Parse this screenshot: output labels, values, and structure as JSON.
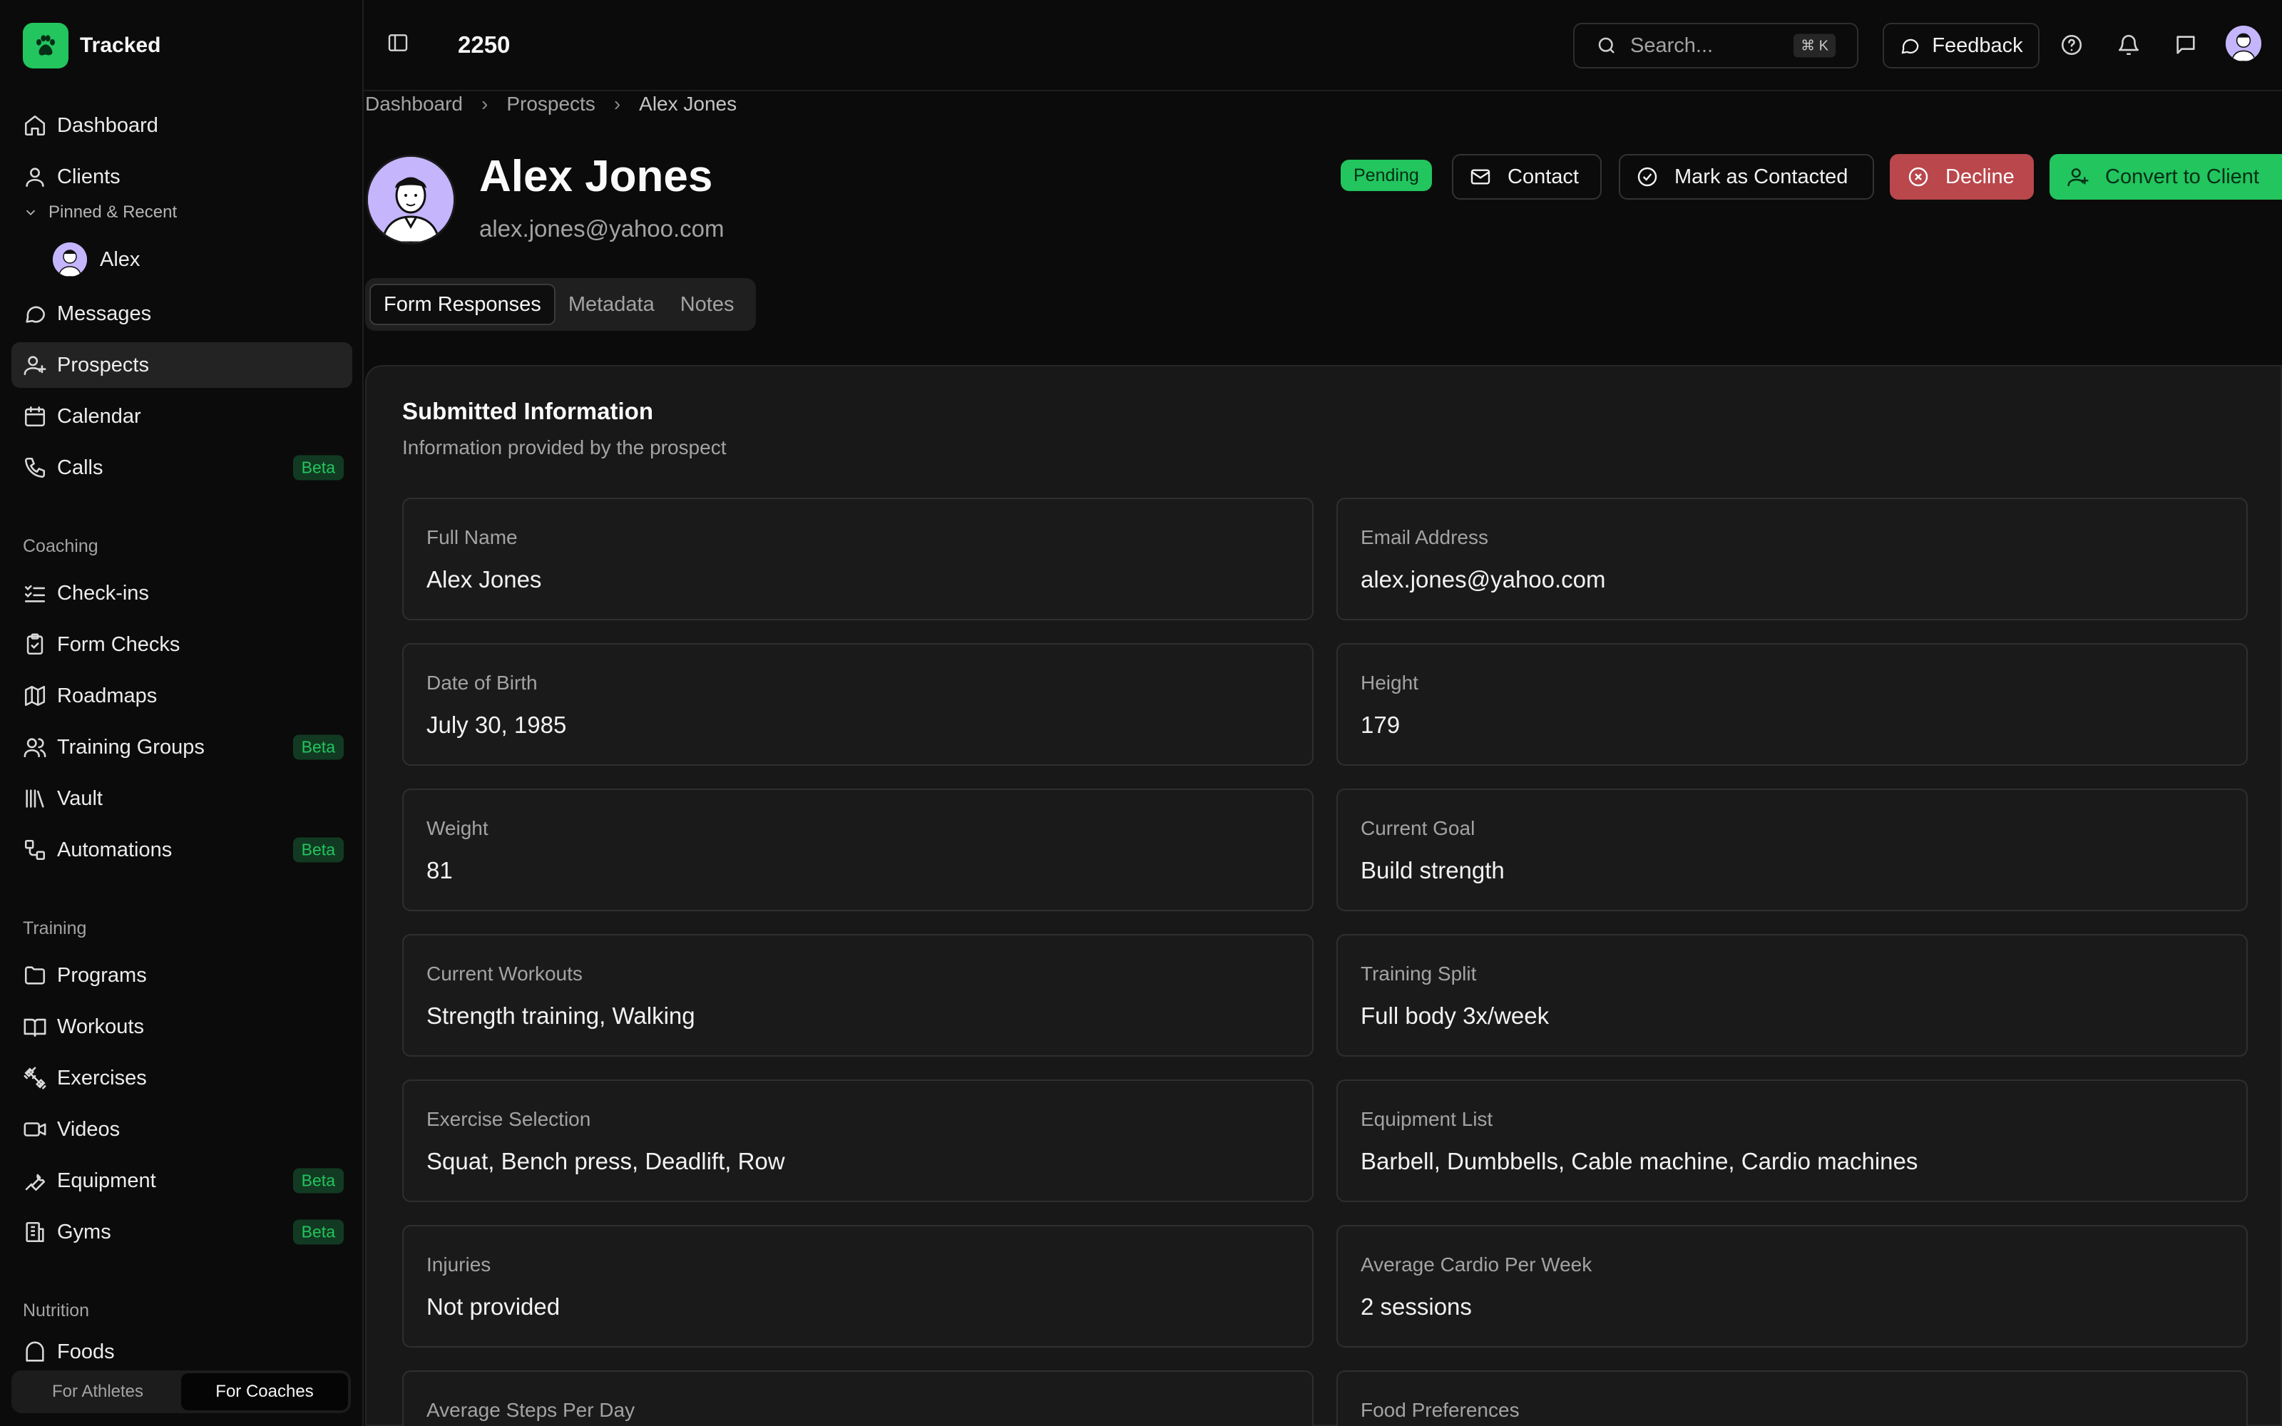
{
  "app": {
    "name": "Tracked",
    "top_number": "2250"
  },
  "sidebar": {
    "main": [
      {
        "label": "Dashboard",
        "icon": "home-icon"
      },
      {
        "label": "Clients",
        "icon": "user-icon"
      },
      {
        "label": "Messages",
        "icon": "message-icon"
      },
      {
        "label": "Prospects",
        "icon": "user-plus-icon",
        "active": true
      },
      {
        "label": "Calendar",
        "icon": "calendar-icon"
      },
      {
        "label": "Calls",
        "icon": "phone-icon",
        "badge": "Beta"
      }
    ],
    "pinned_label": "Pinned & Recent",
    "pinned_user": "Alex",
    "coaching_label": "Coaching",
    "coaching": [
      {
        "label": "Check-ins",
        "icon": "checklist-icon"
      },
      {
        "label": "Form Checks",
        "icon": "clipboard-icon"
      },
      {
        "label": "Roadmaps",
        "icon": "map-icon"
      },
      {
        "label": "Training Groups",
        "icon": "users-icon",
        "badge": "Beta"
      },
      {
        "label": "Vault",
        "icon": "library-icon"
      },
      {
        "label": "Automations",
        "icon": "workflow-icon",
        "badge": "Beta"
      }
    ],
    "training_label": "Training",
    "training": [
      {
        "label": "Programs",
        "icon": "folder-icon"
      },
      {
        "label": "Workouts",
        "icon": "book-icon"
      },
      {
        "label": "Exercises",
        "icon": "dumbbell-icon"
      },
      {
        "label": "Videos",
        "icon": "video-icon"
      },
      {
        "label": "Equipment",
        "icon": "wrench-icon",
        "badge": "Beta"
      },
      {
        "label": "Gyms",
        "icon": "building-icon",
        "badge": "Beta"
      }
    ],
    "nutrition_label": "Nutrition",
    "nutrition": [
      {
        "label": "Foods",
        "icon": "food-icon"
      }
    ],
    "switch": {
      "athletes": "For Athletes",
      "coaches": "For Coaches"
    }
  },
  "topbar": {
    "search_placeholder": "Search...",
    "search_shortcut": "⌘ K",
    "feedback_label": "Feedback"
  },
  "breadcrumb": [
    "Dashboard",
    "Prospects",
    "Alex Jones"
  ],
  "profile": {
    "name": "Alex Jones",
    "email": "alex.jones@yahoo.com",
    "status": "Pending"
  },
  "actions": {
    "contact": "Contact",
    "mark_contacted": "Mark as Contacted",
    "decline": "Decline",
    "convert": "Convert to Client"
  },
  "tabs": [
    "Form Responses",
    "Metadata",
    "Notes"
  ],
  "card": {
    "title": "Submitted Information",
    "subtitle": "Information provided by the prospect",
    "fields": [
      {
        "label": "Full Name",
        "value": "Alex Jones"
      },
      {
        "label": "Email Address",
        "value": "alex.jones@yahoo.com"
      },
      {
        "label": "Date of Birth",
        "value": "July 30, 1985"
      },
      {
        "label": "Height",
        "value": "179"
      },
      {
        "label": "Weight",
        "value": "81"
      },
      {
        "label": "Current Goal",
        "value": "Build strength"
      },
      {
        "label": "Current Workouts",
        "value": "Strength training, Walking"
      },
      {
        "label": "Training Split",
        "value": "Full body 3x/week"
      },
      {
        "label": "Exercise Selection",
        "value": "Squat, Bench press, Deadlift, Row"
      },
      {
        "label": "Equipment List",
        "value": "Barbell, Dumbbells, Cable machine, Cardio machines"
      },
      {
        "label": "Injuries",
        "value": "Not provided"
      },
      {
        "label": "Average Cardio Per Week",
        "value": "2 sessions"
      },
      {
        "label": "Average Steps Per Day",
        "value": ""
      },
      {
        "label": "Food Preferences",
        "value": ""
      }
    ]
  },
  "colors": {
    "accent": "#22c55e",
    "decline": "#b9474c",
    "background": "#0b0b0b",
    "card": "#181818"
  }
}
